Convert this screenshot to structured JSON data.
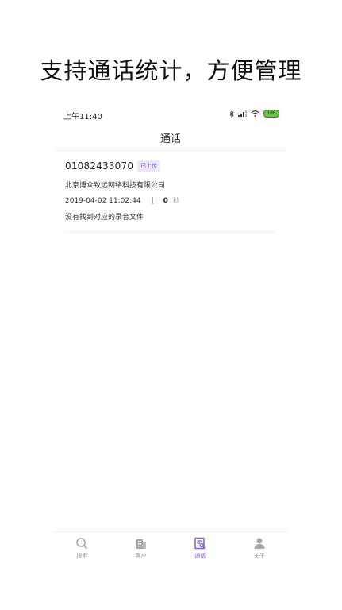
{
  "promo": {
    "title": "支持通话统计，方便管理"
  },
  "status_bar": {
    "time": "上午11:40",
    "battery": "100"
  },
  "nav": {
    "title": "通话"
  },
  "calls": [
    {
      "phone": "01082433070",
      "badge": "已上传",
      "company": "北京博众致远网络科技有限公司",
      "datetime": "2019-04-02 11:02:44",
      "separator": "|",
      "duration_value": "0",
      "duration_unit": "秒",
      "note": "没有找到对应的录音文件"
    }
  ],
  "tabs": [
    {
      "label": "搜索",
      "icon": "search-icon",
      "active": false
    },
    {
      "label": "客户",
      "icon": "building-icon",
      "active": false
    },
    {
      "label": "通话",
      "icon": "call-record-icon",
      "active": true
    },
    {
      "label": "关于",
      "icon": "user-icon",
      "active": false
    }
  ],
  "colors": {
    "accent": "#7c5cd6",
    "badge_bg": "#ece6fb",
    "inactive_tab": "#9a9a9a",
    "battery": "#6cc04a"
  }
}
